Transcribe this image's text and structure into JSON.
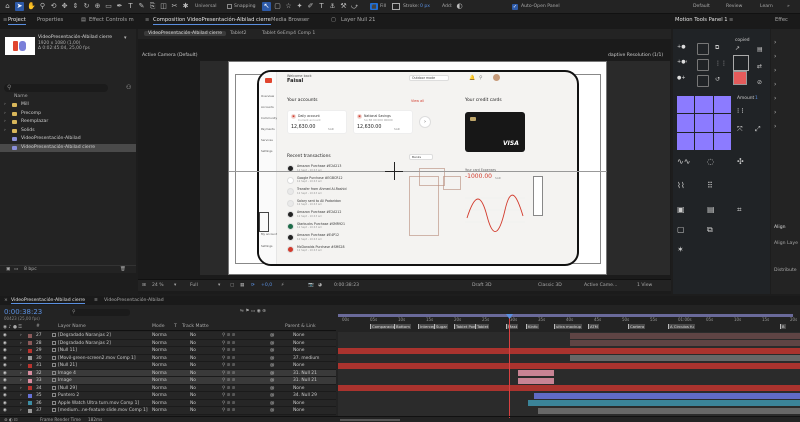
{
  "toolbar": {
    "universal_label": "Universal",
    "snapping_label": "Snapping",
    "fill_label": "Fill",
    "stroke_label": "Stroke:",
    "stroke_value": "0 px",
    "add_label": "Add:",
    "auto_open_label": "Auto-Open Panel",
    "workspaces": [
      "Default",
      "Review",
      "Learn"
    ]
  },
  "panel_tabs": {
    "project": "Project",
    "properties": "Properties",
    "effect_controls": "Effect Controls m",
    "composition": "Composition VideoPresentación-Albilad cierre",
    "media_browser": "Media Browser",
    "layer": "Layer Null 21",
    "motion_tools": "Motion Tools Panel 1",
    "effects": "Effec"
  },
  "project": {
    "item_name": "VideoPresentación-Albilad cierre",
    "item_info": [
      "1920 x 1080 (1,00)",
      "Δ 0:02:45:04, 25,00 fps"
    ],
    "search_placeholder": "",
    "items": [
      {
        "name": "Mill",
        "type": "folder"
      },
      {
        "name": "Precomp",
        "type": "folder"
      },
      {
        "name": "Reemplazar",
        "type": "folder"
      },
      {
        "name": "Solids",
        "type": "folder"
      },
      {
        "name": "VideoPresentación-Albilad",
        "type": "comp"
      },
      {
        "name": "VideoPresentación-Albilad cierre",
        "type": "comp",
        "selected": true
      }
    ],
    "bpc": "8 bpc"
  },
  "comp_viewer": {
    "breadcrumbs": [
      "VideoPresentación-Albilad cierre",
      "Tablet2",
      "Tablet 6eEmp4 Comp 1"
    ],
    "camera_label": "Active Camera (Default)",
    "resolution_label": "daptive Resolution (1/1)",
    "footer": {
      "zoom": "24 %",
      "quality": "Full",
      "exposure": "+0,0",
      "timecode": "0:00:38:23",
      "renderer": "Draft 3D",
      "view_3d": "Classic 3D",
      "camera": "Active Came...",
      "views": "1 View"
    },
    "app": {
      "greeting_small": "Welcome back",
      "greeting_name": "Faisal",
      "dropdown": "Outdoor mode",
      "sidebar": [
        "Overview",
        "Accounts",
        "Community",
        "Payments",
        "Services",
        "Settings",
        "My account",
        "Settings"
      ],
      "accounts_title": "Your accounts",
      "accounts_link": "View all",
      "account_cards": [
        {
          "label": "Daily account",
          "sublabel": "Current account",
          "amount": "12,630.00",
          "currency": "SAR"
        },
        {
          "label": "National Savings",
          "sublabel": "SA 88 00 000 00000",
          "amount": "12,630.00",
          "currency": "SAR"
        }
      ],
      "cards_title": "Your credit cards",
      "card_brand": "VISA",
      "card_spend_label": "Your card Expenses",
      "card_spend_amount": "-1000.00",
      "card_spend_currency": "SAR",
      "transactions_title": "Recent transactions",
      "transactions_filter": "Banks",
      "transactions": [
        {
          "name": "Amazon Purchase #E2A213",
          "sub": "12 Sept - 10:43 am"
        },
        {
          "name": "Google Purchase #EGBCR12",
          "sub": "12 Sept - 10:43 am"
        },
        {
          "name": "Transfer from Ahmed Al-Rashid",
          "sub": "12 Sept - 10:43 am"
        },
        {
          "name": "Salary sent to Ali Padaridan",
          "sub": "12 Sept - 10:43 am"
        },
        {
          "name": "Amazon Purchase #E2A212",
          "sub": "12 Sept - 10:43 am"
        },
        {
          "name": "Starbucks Purchase #SMR921",
          "sub": "12 Sept - 10:43 am"
        },
        {
          "name": "Amazon Purchase #E4P12",
          "sub": "12 Sept - 10:43 am"
        },
        {
          "name": "McDonalds Purchase #SMS28",
          "sub": "12 Sept - 10:43 am"
        }
      ]
    }
  },
  "motion_tools": {
    "copied_label": "copied",
    "amount_label": "Amount",
    "amount_value": "1",
    "right_labels": [
      "Align",
      "Align Laye",
      "Distribute"
    ]
  },
  "timeline": {
    "tabs": [
      "VideoPresentación-Albilad cierre",
      "VideoPresentación-Albilad"
    ],
    "timecode": "0:00:38:23",
    "timecode_sub": "00423 (25,00 fps)",
    "search_placeholder": "",
    "columns": [
      "Layer Name",
      "Mode",
      "T",
      "Track Matte",
      "Parent & Link"
    ],
    "ruler": [
      "00s",
      "05s",
      "10s",
      "15s",
      "20s",
      "25s",
      "30s",
      "35s",
      "40s",
      "45s",
      "50s",
      "55s",
      "01:00s",
      "05s",
      "10s",
      "15s",
      "20s"
    ],
    "markers": [
      "Comparaciones",
      "Bottom",
      "Intercept",
      "Sugar",
      "Tablet Pon",
      "Tablet",
      "Mast",
      "Kinfo",
      "ultra mockup",
      "ATM",
      "Cartera",
      "A Circulos fu",
      "B"
    ],
    "layers": [
      {
        "num": "27",
        "name": "[Degradado Naranjas 2]",
        "mode": "Norma",
        "matte": "No",
        "parent": "None",
        "color": "#8b5a5a"
      },
      {
        "num": "28",
        "name": "[Degradado Naranjas 2]",
        "mode": "Norma",
        "matte": "No",
        "parent": "None",
        "color": "#8b5a5a"
      },
      {
        "num": "29",
        "name": "[Null 11]",
        "mode": "Norma",
        "matte": "No",
        "parent": "None",
        "color": "#b8342f"
      },
      {
        "num": "30",
        "name": "[Movil-green-screen2.mov Comp 1]",
        "mode": "Norma",
        "matte": "No",
        "parent": "37. medium",
        "color": "#999"
      },
      {
        "num": "31",
        "name": "[Null 21]",
        "mode": "Norma",
        "matte": "No",
        "parent": "None",
        "color": "#b8342f"
      },
      {
        "num": "32",
        "name": "Image 4",
        "mode": "Norma",
        "matte": "No",
        "parent": "31. Null 21",
        "color": "#d98da0"
      },
      {
        "num": "33",
        "name": "Image",
        "mode": "Norma",
        "matte": "No",
        "parent": "31. Null 21",
        "color": "#d98da0"
      },
      {
        "num": "34",
        "name": "[Null 29]",
        "mode": "Norma",
        "matte": "No",
        "parent": "None",
        "color": "#b8342f"
      },
      {
        "num": "35",
        "name": "Puntero 2",
        "mode": "Norma",
        "matte": "No",
        "parent": "34. Null 29",
        "color": "#6671d6"
      },
      {
        "num": "36",
        "name": "Apple Watch Ultra turn.mov Comp 1]",
        "mode": "Norma",
        "matte": "No",
        "parent": "None",
        "color": "#3d8ea5"
      },
      {
        "num": "37",
        "name": "[medium...ne-feature slide.mov Comp 1]",
        "mode": "Norma",
        "matte": "No",
        "parent": "None",
        "color": "#999"
      }
    ],
    "frame_render_label": "Frame Render Time",
    "frame_render_value": "182ms"
  }
}
